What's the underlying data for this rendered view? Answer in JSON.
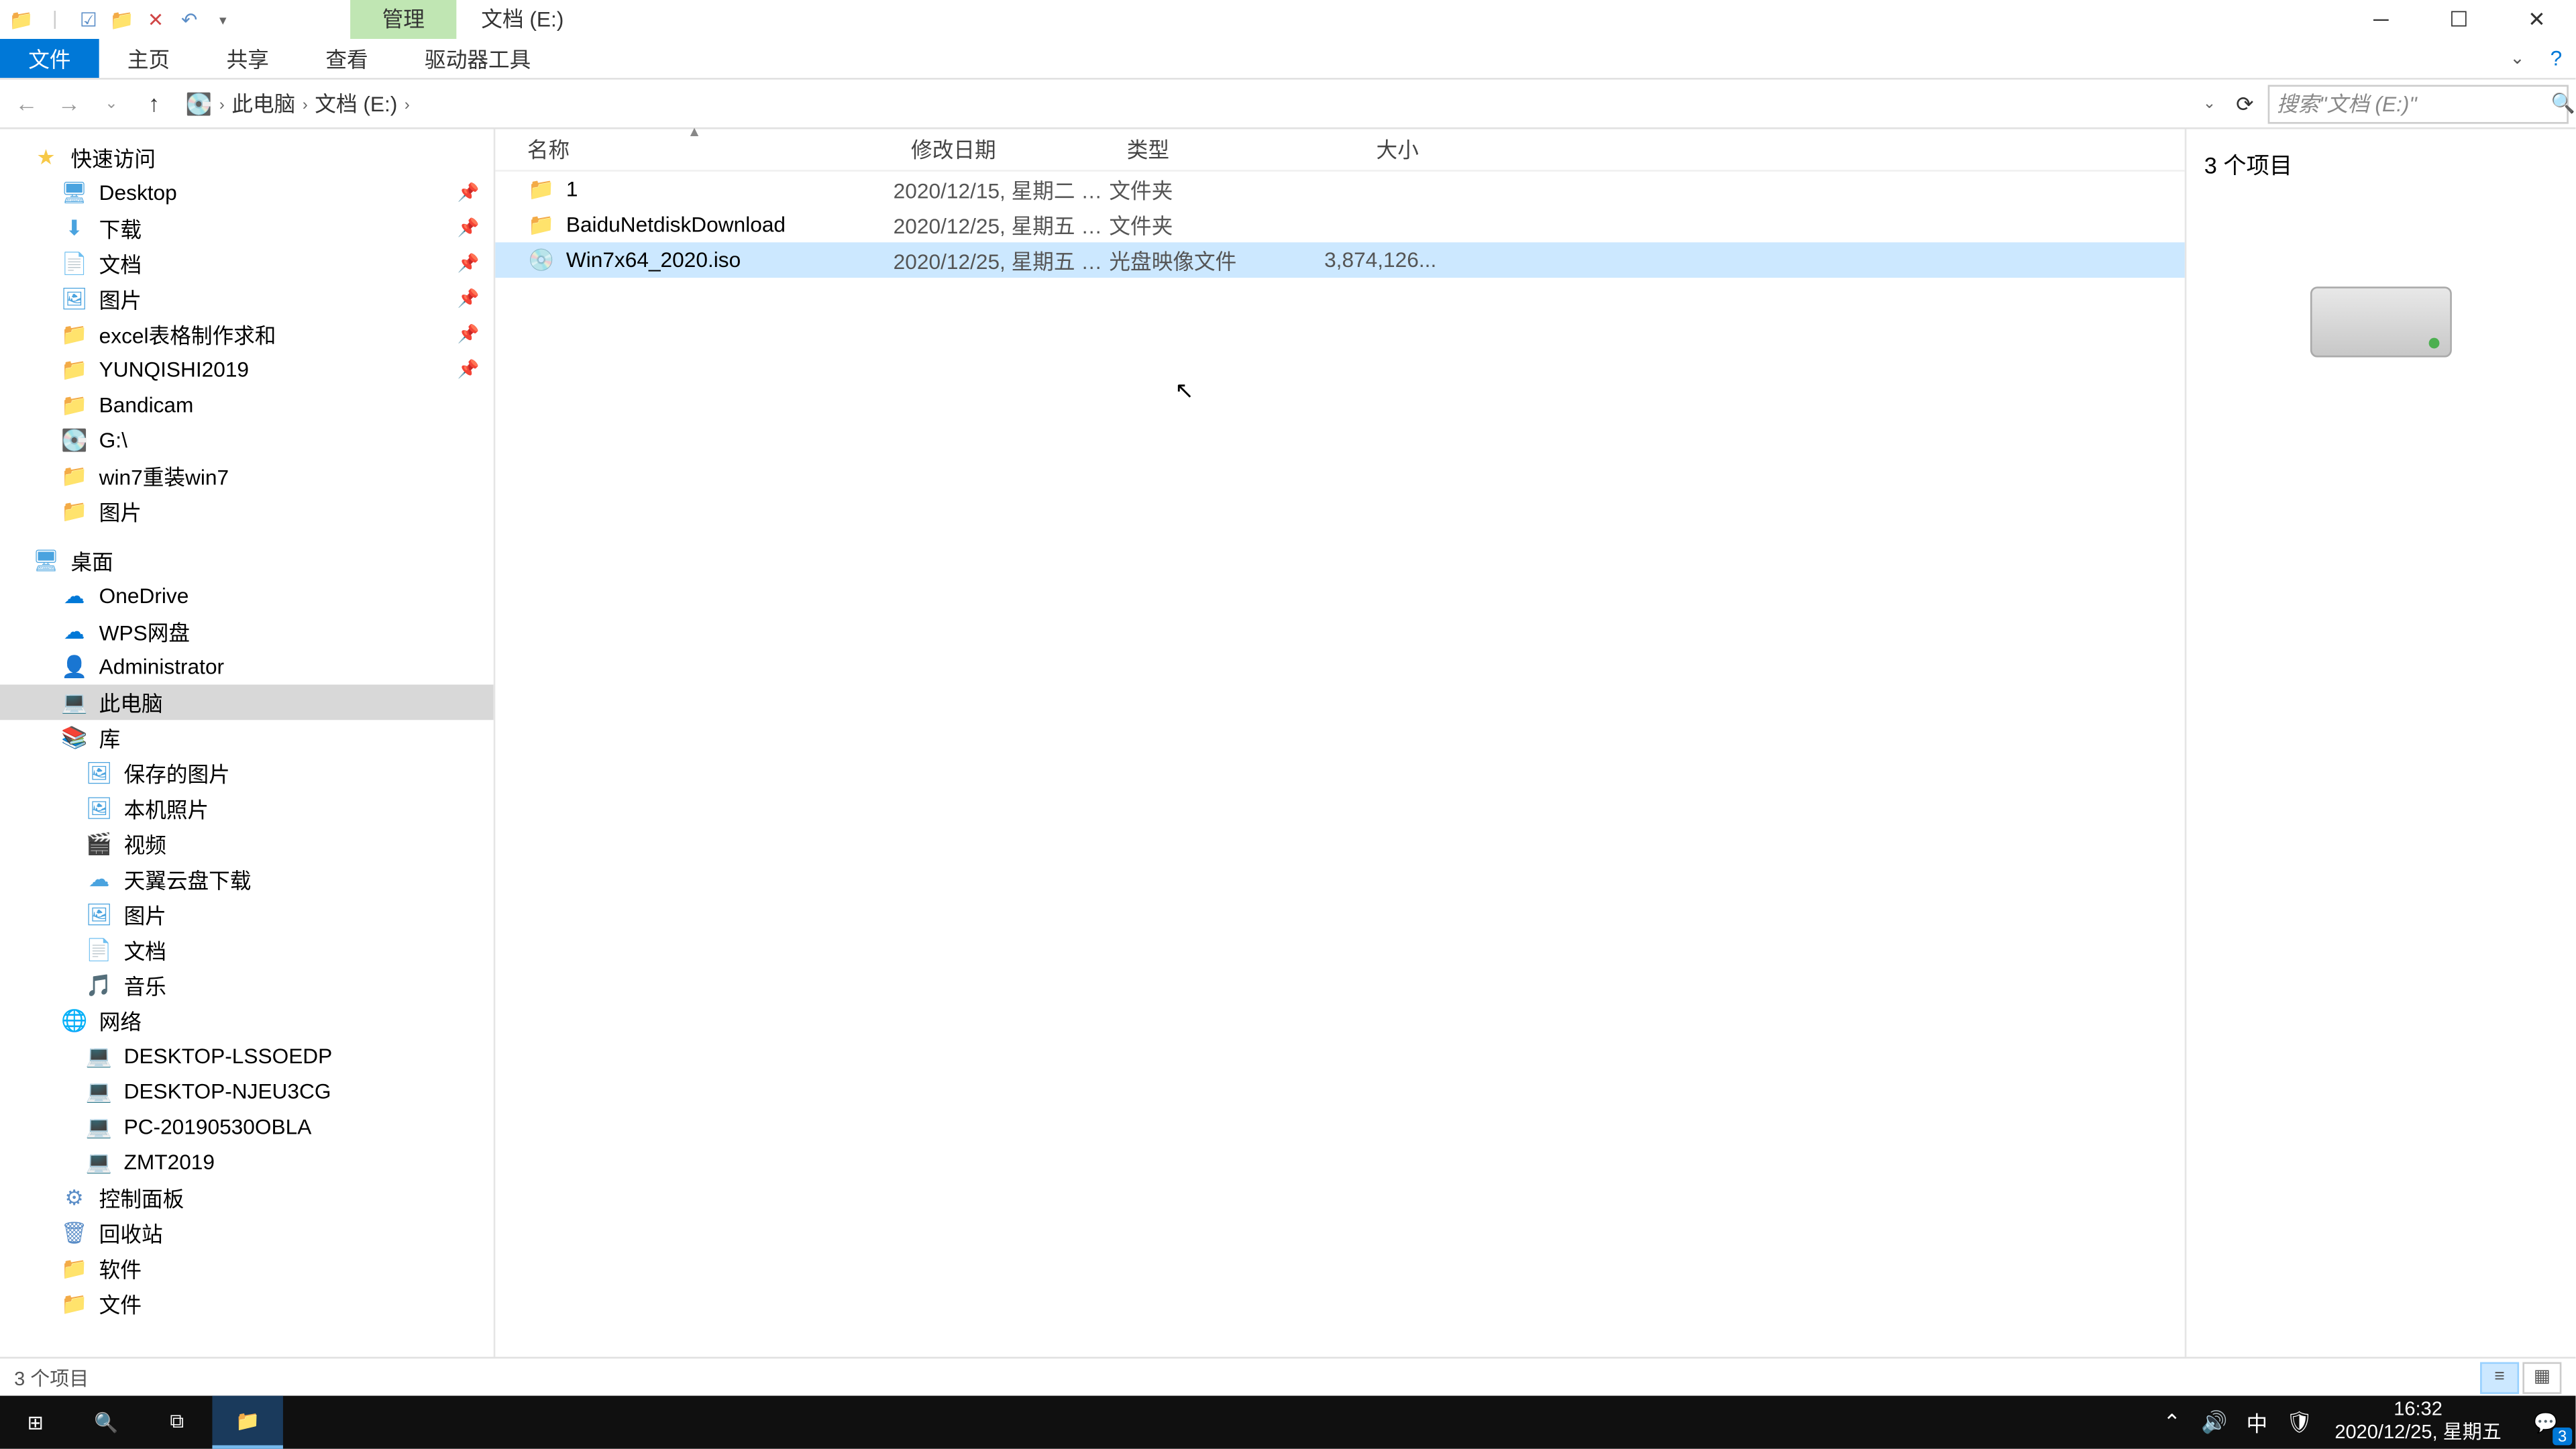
{
  "titlebar": {
    "manage_tab": "管理",
    "title": "文档 (E:)"
  },
  "ribbon": {
    "file": "文件",
    "home": "主页",
    "share": "共享",
    "view": "查看",
    "drive_tools": "驱动器工具"
  },
  "address": {
    "seg1": "此电脑",
    "seg2": "文档 (E:)"
  },
  "search": {
    "placeholder": "搜索\"文档 (E:)\""
  },
  "nav": {
    "quick_access": "快速访问",
    "desktop": "Desktop",
    "downloads": "下载",
    "documents": "文档",
    "pictures": "图片",
    "excel": "excel表格制作求和",
    "yunqishi": "YUNQISHI2019",
    "bandicam": "Bandicam",
    "gdrive": "G:\\",
    "win7reinstall": "win7重装win7",
    "pictures2": "图片",
    "desktop_zh": "桌面",
    "onedrive": "OneDrive",
    "wps": "WPS网盘",
    "admin": "Administrator",
    "thispc": "此电脑",
    "library": "库",
    "saved_pics": "保存的图片",
    "camera_roll": "本机照片",
    "videos": "视频",
    "tianyi": "天翼云盘下载",
    "pictures3": "图片",
    "documents2": "文档",
    "music": "音乐",
    "network": "网络",
    "pc1": "DESKTOP-LSSOEDP",
    "pc2": "DESKTOP-NJEU3CG",
    "pc3": "PC-20190530OBLA",
    "pc4": "ZMT2019",
    "control_panel": "控制面板",
    "recycle": "回收站",
    "software": "软件",
    "files": "文件"
  },
  "columns": {
    "name": "名称",
    "date": "修改日期",
    "type": "类型",
    "size": "大小"
  },
  "files": [
    {
      "icon": "folder",
      "name": "1",
      "date": "2020/12/15, 星期二 1...",
      "type": "文件夹",
      "size": ""
    },
    {
      "icon": "folder",
      "name": "BaiduNetdiskDownload",
      "date": "2020/12/25, 星期五 1...",
      "type": "文件夹",
      "size": ""
    },
    {
      "icon": "disc",
      "name": "Win7x64_2020.iso",
      "date": "2020/12/25, 星期五 1...",
      "type": "光盘映像文件",
      "size": "3,874,126...",
      "selected": true
    }
  ],
  "preview": {
    "count": "3 个项目"
  },
  "status": {
    "text": "3 个项目"
  },
  "taskbar": {
    "time": "16:32",
    "date": "2020/12/25, 星期五",
    "ime": "中",
    "notif_badge": "3"
  }
}
